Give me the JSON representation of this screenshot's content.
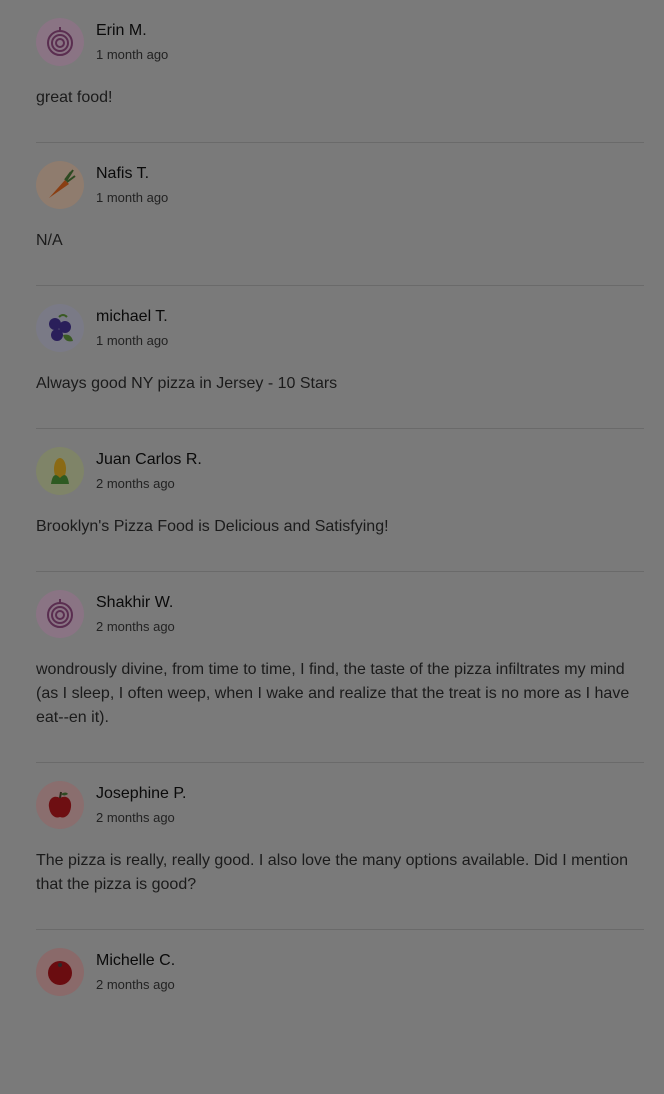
{
  "reviews": [
    {
      "name": "Erin M.",
      "time": "1 month ago",
      "text": "great food!",
      "avatar": "onion-icon",
      "avatar_bg": "#8a7484"
    },
    {
      "name": "Nafis T.",
      "time": "1 month ago",
      "text": "N/A",
      "avatar": "carrot-icon",
      "avatar_bg": "#8f7c6e"
    },
    {
      "name": "michael T.",
      "time": "1 month ago",
      "text": "Always good NY pizza in Jersey - 10 Stars",
      "avatar": "blueberry-icon",
      "avatar_bg": "#7a7a86"
    },
    {
      "name": "Juan Carlos R.",
      "time": "2 months ago",
      "text": "Brooklyn's Pizza Food is Delicious and Satisfying!",
      "avatar": "corn-icon",
      "avatar_bg": "#7f8468"
    },
    {
      "name": "Shakhir W.",
      "time": "2 months ago",
      "text": "wondrously divine, from time to time, I find, the taste of the pizza infiltrates my mind (as I sleep, I often weep, when I wake and realize that the treat is no more as I have eat--en it).",
      "avatar": "onion-icon",
      "avatar_bg": "#8a7484"
    },
    {
      "name": "Josephine P.",
      "time": "2 months ago",
      "text": "The pizza is really, really good. I also love the many options available. Did I mention that the pizza is good?",
      "avatar": "apple-icon",
      "avatar_bg": "#8a6e6e"
    },
    {
      "name": "Michelle C.",
      "time": "2 months ago",
      "text": "",
      "avatar": "tomato-icon",
      "avatar_bg": "#8a6a6a"
    }
  ]
}
